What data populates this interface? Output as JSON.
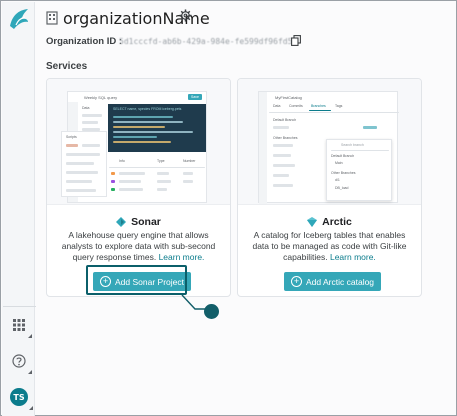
{
  "header": {
    "org_name": "organizationName",
    "org_id_label": "Organization ID :",
    "org_id_value": "5d1cccfd-ab6b-429a-984e-fe599df96fd5"
  },
  "services_title": "Services",
  "sonar": {
    "title": "Sonar",
    "description": "A lakehouse query engine that allows analysts to explore data with sub-second query response times.",
    "learn_more": "Learn more.",
    "button_label": "Add Sonar Project",
    "preview": {
      "title": "Weekly SQL query",
      "button": "Save",
      "tab_data": "Data",
      "script_label": "Scripts",
      "code_text": "SELECT name, species FROM iceberg.pets",
      "table_headers": [
        "Info",
        "Type",
        "Number"
      ]
    }
  },
  "arctic": {
    "title": "Arctic",
    "description": "A catalog for Iceberg tables that enables data to be managed as code with Git-like capabilities.",
    "learn_more": "Learn more.",
    "button_label": "Add Arctic catalog",
    "preview": {
      "title": "MyFirstCatalog",
      "tabs": [
        "Data",
        "Commits",
        "Branches",
        "Tags"
      ],
      "default_branch": "Default Branch",
      "other_branches": "Other Branches",
      "search_placeholder": "Search branch",
      "branches": [
        "Main",
        "d/1",
        "DB_load"
      ]
    }
  },
  "sidebar": {
    "avatar_initials": "TS"
  },
  "colors": {
    "accent": "#35a7b8",
    "brand_dark": "#0b5f6a",
    "avatar": "#0b7c8c"
  }
}
